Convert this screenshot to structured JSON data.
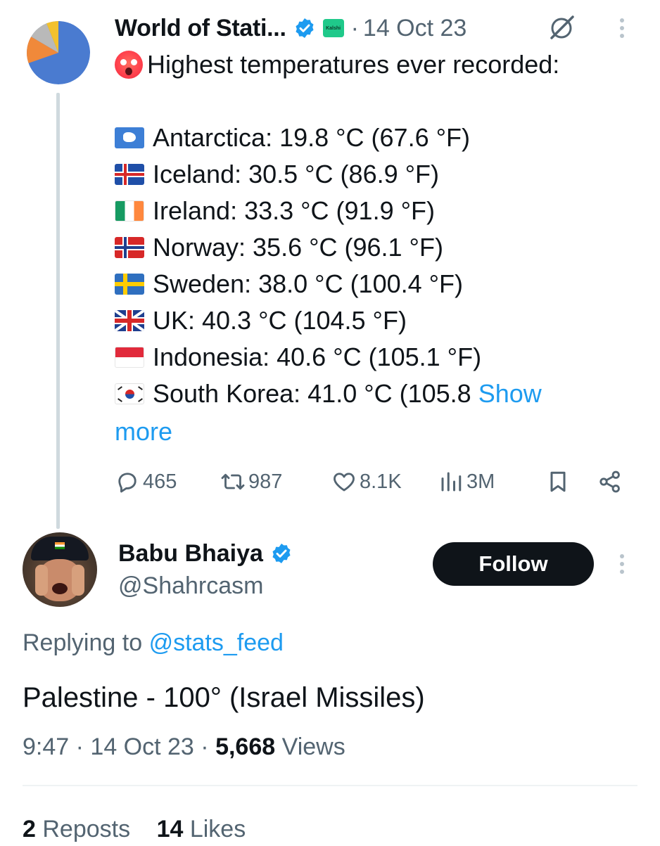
{
  "tweet": {
    "author_name": "World of Stati...",
    "affiliate_badge": "Kalshi",
    "date": "14 Oct 23",
    "title_emoji": "hot-face-emoji",
    "title": "Highest temperatures ever recorded:",
    "records": [
      {
        "flag": "antarctica-flag-icon",
        "text": "Antarctica: 19.8 °C (67.6 °F)"
      },
      {
        "flag": "iceland-flag-icon",
        "text": "Iceland: 30.5 °C (86.9 °F)"
      },
      {
        "flag": "ireland-flag-icon",
        "text": "Ireland: 33.3 °C (91.9 °F)"
      },
      {
        "flag": "norway-flag-icon",
        "text": "Norway: 35.6 °C (96.1 °F)"
      },
      {
        "flag": "sweden-flag-icon",
        "text": "Sweden: 38.0 °C (100.4 °F)"
      },
      {
        "flag": "uk-flag-icon",
        "text": "UK: 40.3 °C (104.5 °F)"
      },
      {
        "flag": "indonesia-flag-icon",
        "text": "Indonesia: 40.6 °C (105.1 °F)"
      },
      {
        "flag": "south-korea-flag-icon",
        "text": "South Korea: 41.0 °C (105.8"
      }
    ],
    "show_more_first": "Show",
    "show_more_second": "more",
    "actions": {
      "replies": "465",
      "reposts": "987",
      "likes": "8.1K",
      "views": "3M"
    }
  },
  "reply": {
    "author_name": "Babu Bhaiya",
    "handle": "@Shahrcasm",
    "follow_label": "Follow",
    "replying_prefix": "Replying to",
    "replying_to": "@stats_feed",
    "body": "Palestine - 100° (Israel Missiles)",
    "time": "9:47",
    "date": "14 Oct 23",
    "views_count": "5,668",
    "views_label": "Views",
    "reposts_count": "2",
    "reposts_label": "Reposts",
    "likes_count": "14",
    "likes_label": "Likes"
  },
  "colors": {
    "link": "#1d9bf0",
    "text": "#0f1419",
    "muted": "#536471",
    "verified": "#1d9bf0",
    "follow_bg": "#0f1419"
  }
}
